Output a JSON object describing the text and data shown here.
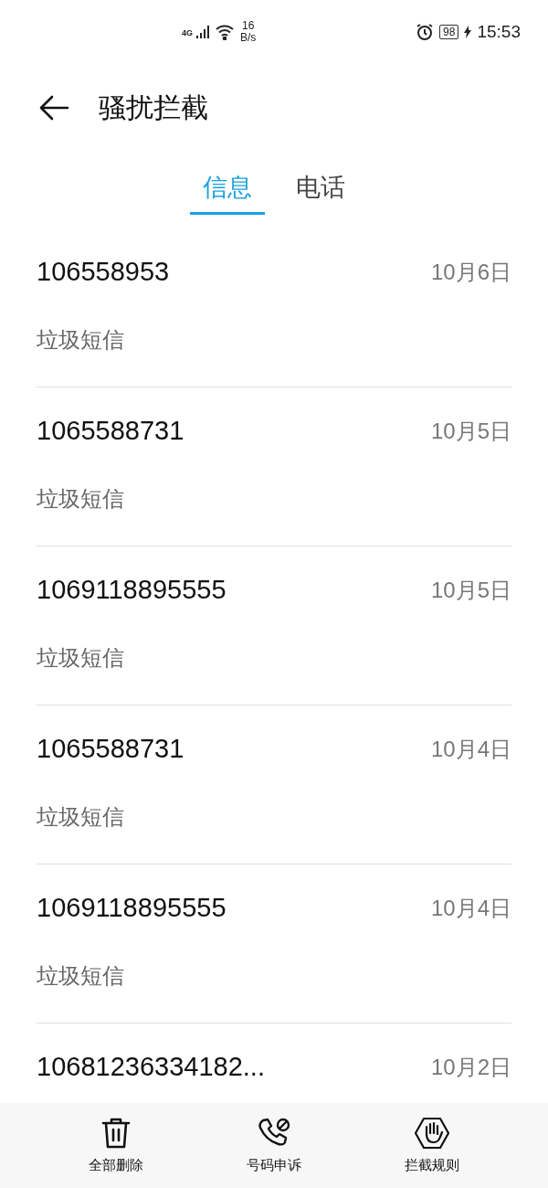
{
  "status_bar": {
    "network": "4G",
    "speed_value": "16",
    "speed_unit": "B/s",
    "battery": "98",
    "time": "15:53"
  },
  "header": {
    "title": "骚扰拦截"
  },
  "tabs": [
    {
      "label": "信息",
      "selected": true
    },
    {
      "label": "电话",
      "selected": false
    }
  ],
  "messages": [
    {
      "number": "106558953",
      "date": "10月6日",
      "subtitle": "垃圾短信"
    },
    {
      "number": "1065588731",
      "date": "10月5日",
      "subtitle": "垃圾短信"
    },
    {
      "number": "1069118895555",
      "date": "10月5日",
      "subtitle": "垃圾短信"
    },
    {
      "number": "1065588731",
      "date": "10月4日",
      "subtitle": "垃圾短信"
    },
    {
      "number": "1069118895555",
      "date": "10月4日",
      "subtitle": "垃圾短信"
    },
    {
      "number": "10681236334182...",
      "date": "10月2日"
    }
  ],
  "toolbar": [
    {
      "kind": "delete",
      "label": "全部删除"
    },
    {
      "kind": "appeal",
      "label": "号码申诉"
    },
    {
      "kind": "rules",
      "label": "拦截规则"
    }
  ]
}
